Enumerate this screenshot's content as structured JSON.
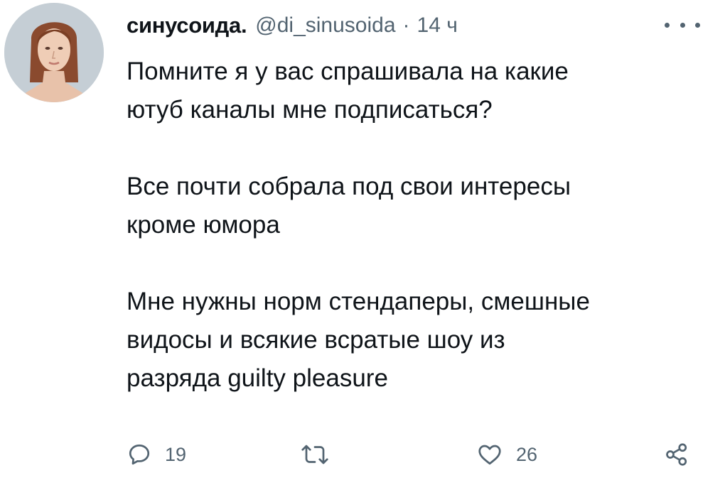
{
  "tweet": {
    "author": {
      "display_name": "синусоида.",
      "handle": "@di_sinusoida",
      "separator": "·",
      "time": "14 ч"
    },
    "text": {
      "p1_line1": "Помните я у вас спрашивала на какие",
      "p1_line2": "ютуб каналы мне подписаться?",
      "p2_line1": "Все почти собрала под свои интересы",
      "p2_line2": "кроме юмора",
      "p3_line1": "Мне нужны норм стендаперы, смешные",
      "p3_line2": "видосы и всякие всратые шоу из",
      "p3_line3": "разряда guilty pleasure"
    },
    "actions": {
      "replies": "19",
      "retweets": "",
      "likes": "26"
    },
    "icons": {
      "more": "more-icon",
      "reply": "reply-icon",
      "retweet": "retweet-icon",
      "like": "like-icon",
      "share": "share-icon"
    },
    "colors": {
      "text": "#0f1419",
      "secondary": "#536471",
      "background": "#ffffff"
    }
  }
}
